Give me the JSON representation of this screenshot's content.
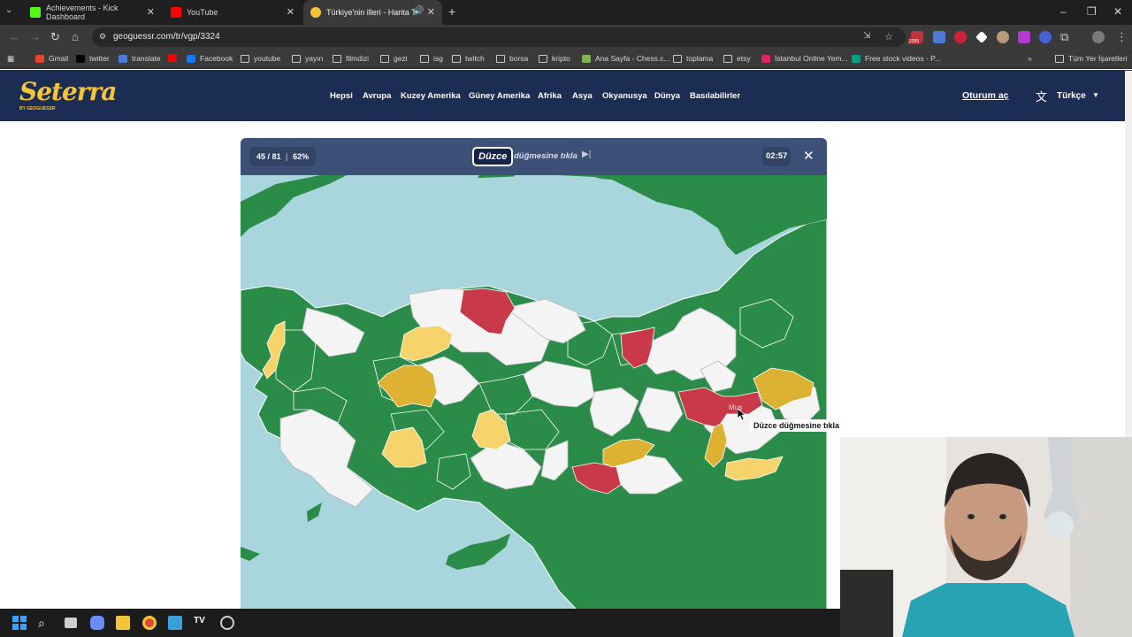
{
  "browser": {
    "tabs": [
      {
        "title": "Achievements - Kick Dashboard",
        "favicon_color": "#53fc18",
        "active": false
      },
      {
        "title": "YouTube",
        "favicon_color": "#ff0000",
        "active": false
      },
      {
        "title": "Türkiye'nin illeri - Harita Te",
        "favicon_color": "#f6c537",
        "active": true
      }
    ],
    "url": "geoguessr.com/tr/vgp/3324",
    "extension_badge": "2395",
    "bookmarks": [
      {
        "label": "Gmail",
        "icon": "gmail-icon"
      },
      {
        "label": "twitter",
        "icon": "x-icon"
      },
      {
        "label": "translate",
        "icon": "translate-icon"
      },
      {
        "label": "",
        "icon": "youtube-icon"
      },
      {
        "label": "Facebook",
        "icon": "facebook-icon"
      },
      {
        "label": "youtube",
        "icon": "folder-icon"
      },
      {
        "label": "yayın",
        "icon": "folder-icon"
      },
      {
        "label": "filmdizi",
        "icon": "folder-icon"
      },
      {
        "label": "gezi",
        "icon": "folder-icon"
      },
      {
        "label": "isg",
        "icon": "folder-icon"
      },
      {
        "label": "twitch",
        "icon": "folder-icon"
      },
      {
        "label": "borsa",
        "icon": "folder-icon"
      },
      {
        "label": "kripto",
        "icon": "folder-icon"
      },
      {
        "label": "Ana Sayfa - Chess.c...",
        "icon": "chess-icon"
      },
      {
        "label": "toplama",
        "icon": "folder-icon"
      },
      {
        "label": "etsy",
        "icon": "folder-icon"
      },
      {
        "label": "İstanbul Online Yem...",
        "icon": "yemek-icon"
      },
      {
        "label": "Free stock videos - P...",
        "icon": "pexels-icon"
      }
    ],
    "all_bookmarks_label": "Tüm Yer İşaretleri"
  },
  "site": {
    "logo_text": "Seterra",
    "logo_sub": "BY GEOGUESSR",
    "nav": [
      "Hepsi",
      "Avrupa",
      "Kuzey Amerika",
      "Güney Amerika",
      "Afrika",
      "Asya",
      "Okyanusya",
      "Dünya",
      "Basılabilirler"
    ],
    "login": "Oturum aç",
    "language": "Türkçe"
  },
  "game": {
    "progress": "45 / 81",
    "percent": "62%",
    "target": "Düzce",
    "prompt_suffix": "düğmesine tıkla",
    "timer": "02:57",
    "hover_province": "Muş",
    "tooltip": "Düzce düğmesine tıkla",
    "colors": {
      "correct": "#2a8c48",
      "second_try": "#f6d36b",
      "third_try": "#ddb232",
      "wrong": "#c9394a",
      "remaining": "#f4f4f4",
      "sea": "#a9d5dc",
      "border": "#b8b8b8"
    }
  },
  "taskbar": {
    "icons": [
      "windows-start-icon",
      "search-icon",
      "task-view-icon",
      "copilot-icon",
      "file-explorer-icon",
      "chrome-icon",
      "store-icon",
      "tradingview-icon",
      "steam-icon"
    ]
  }
}
